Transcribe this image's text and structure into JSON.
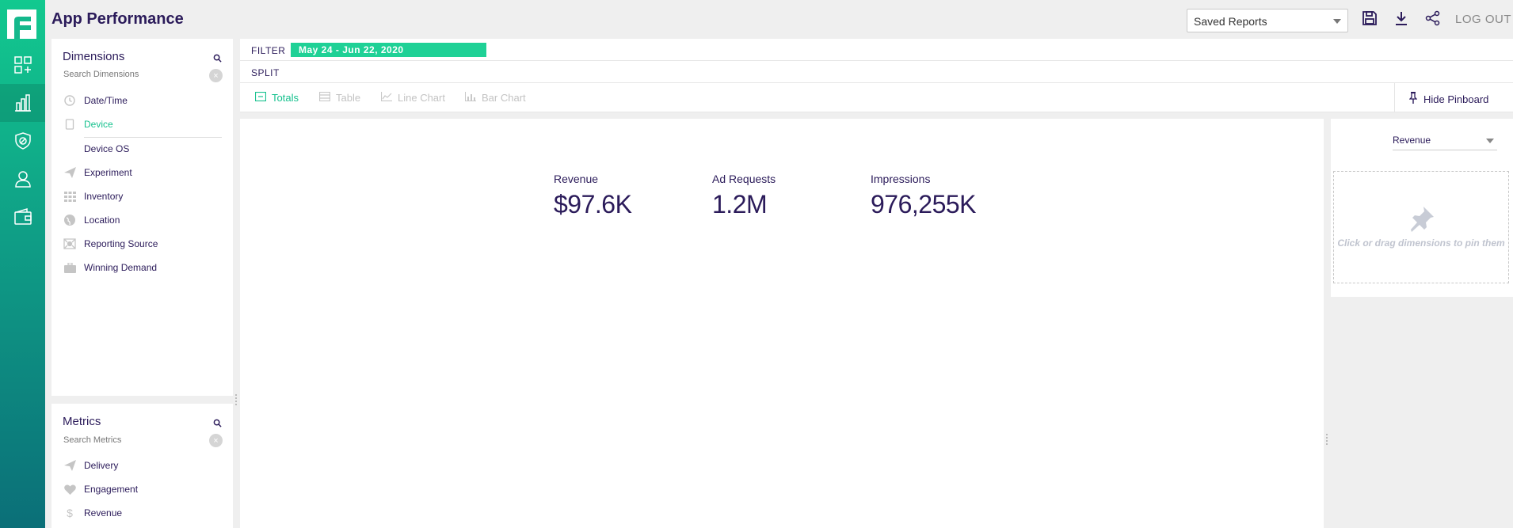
{
  "header": {
    "title": "App Performance",
    "saved_reports": "Saved Reports",
    "logout": "LOG OUT"
  },
  "dimensions": {
    "title": "Dimensions",
    "search_placeholder": "Search Dimensions",
    "items": [
      {
        "label": "Date/Time",
        "icon": "clock-icon"
      },
      {
        "label": "Device",
        "icon": "device-icon",
        "active": true
      },
      {
        "label": "Device OS",
        "icon": "",
        "sub": true
      },
      {
        "label": "Experiment",
        "icon": "paper-plane-icon"
      },
      {
        "label": "Inventory",
        "icon": "grid-icon"
      },
      {
        "label": "Location",
        "icon": "globe-icon"
      },
      {
        "label": "Reporting Source",
        "icon": "source-icon"
      },
      {
        "label": "Winning Demand",
        "icon": "briefcase-icon"
      }
    ]
  },
  "metrics": {
    "title": "Metrics",
    "search_placeholder": "Search Metrics",
    "items": [
      {
        "label": "Delivery",
        "icon": "paper-plane-icon"
      },
      {
        "label": "Engagement",
        "icon": "heart-icon"
      },
      {
        "label": "Revenue",
        "icon": "dollar-icon"
      }
    ]
  },
  "filter": {
    "label": "FILTER",
    "chip": "May 24 - Jun 22, 2020"
  },
  "split": {
    "label": "SPLIT"
  },
  "viz_tabs": [
    {
      "label": "Totals",
      "active": true
    },
    {
      "label": "Table"
    },
    {
      "label": "Line Chart"
    },
    {
      "label": "Bar Chart"
    }
  ],
  "hide_pinboard": "Hide Pinboard",
  "kpis": [
    {
      "label": "Revenue",
      "value": "$97.6K"
    },
    {
      "label": "Ad Requests",
      "value": "1.2M"
    },
    {
      "label": "Impressions",
      "value": "976,255K"
    }
  ],
  "pinboard": {
    "selected": "Revenue",
    "hint": "Click or drag dimensions to pin them"
  }
}
